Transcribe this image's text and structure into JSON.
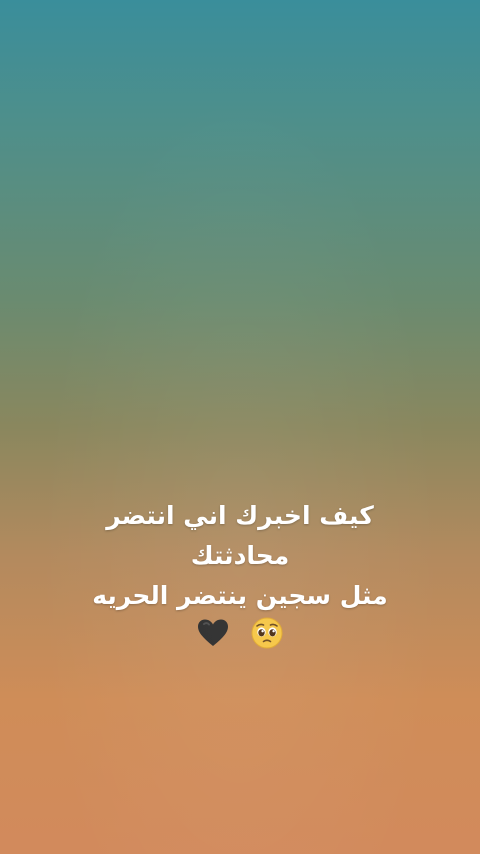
{
  "quote": {
    "line1": "كيف اخبرك اني انتضر",
    "line2": "محادثتك",
    "line3": "مثل سجين ينتضر الحريه"
  },
  "emojis": [
    "black-heart-icon",
    "pleading-face-icon"
  ]
}
